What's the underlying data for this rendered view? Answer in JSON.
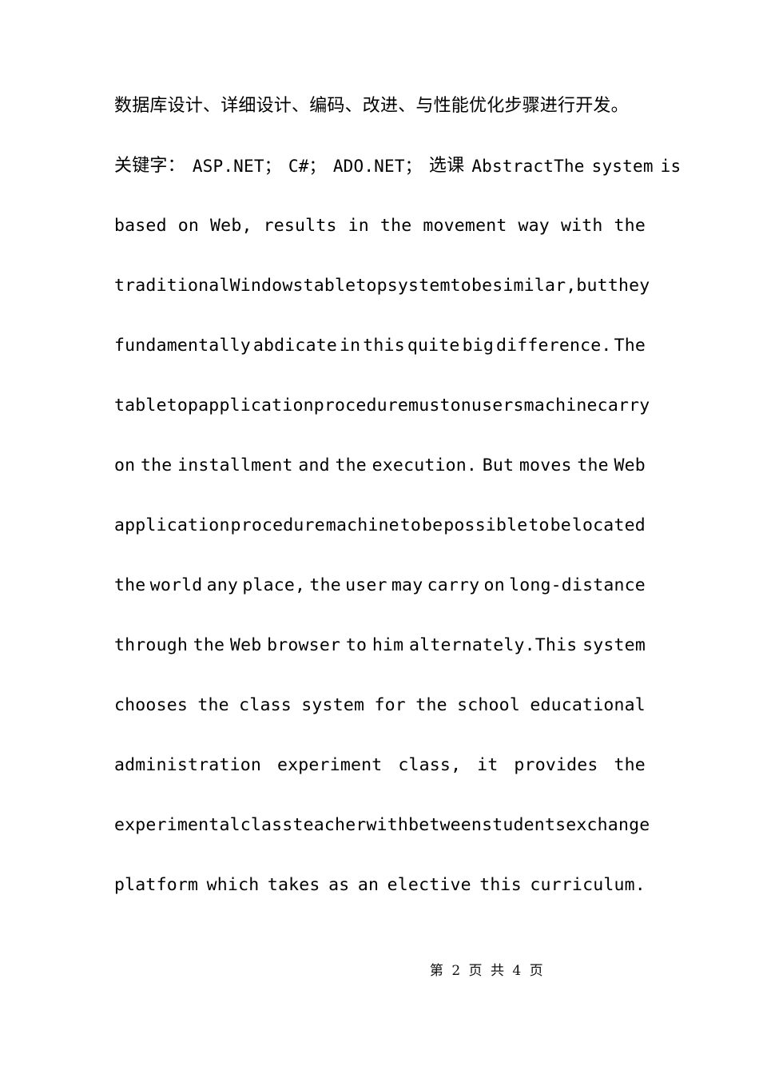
{
  "document": {
    "page_background": "#ffffff",
    "text_color": "#000000",
    "body_lines": [
      {
        "id": "line-1",
        "kind": "cjk-paragraph",
        "align": "natural",
        "text": "数据库设计、详细设计、编码、改进、与性能优化步骤进行开发。",
        "words": [
          "数据库设计、详细设计、编码、改进、与性能优化步骤进行开发。"
        ]
      },
      {
        "id": "line-2",
        "kind": "cjk-mixed",
        "align": "natural",
        "text": "关键字：ASP.NET；C#；ADO.NET；选课 AbstractThe system is",
        "words": [
          "关键字：",
          "ASP.NET；",
          "C#；",
          "ADO.NET；",
          "选课",
          "AbstractThe",
          "system",
          "is"
        ]
      },
      {
        "id": "line-3",
        "kind": "latin",
        "align": "justify",
        "text": "based on Web, results in the movement way with the",
        "words": [
          "based",
          "on",
          "Web,",
          "results",
          "in",
          "the",
          "movement",
          "way",
          "with",
          "the"
        ]
      },
      {
        "id": "line-4",
        "kind": "latin",
        "align": "justify",
        "text": "traditional Windows tabletop system to be similar, but they",
        "words": [
          "traditional",
          "Windows",
          "tabletop",
          "system",
          "to",
          "be",
          "similar,",
          "but",
          "they"
        ]
      },
      {
        "id": "line-5",
        "kind": "latin",
        "align": "justify",
        "text": "fundamentally abdicate in this quite big difference. The",
        "words": [
          "fundamentally",
          "abdicate",
          "in",
          "this",
          "quite",
          "big",
          "difference.",
          "The"
        ]
      },
      {
        "id": "line-6",
        "kind": "latin",
        "align": "justify",
        "text": "tabletop application procedure must on users machine carry",
        "words": [
          "tabletop",
          "application",
          "procedure",
          "must",
          "on",
          "users",
          "machine",
          "carry"
        ]
      },
      {
        "id": "line-7",
        "kind": "latin",
        "align": "justify",
        "text": "on the installment and the execution. But moves the Web",
        "words": [
          "on",
          "the",
          "installment",
          "and",
          "the",
          "execution.",
          "But",
          "moves",
          "the",
          "Web"
        ]
      },
      {
        "id": "line-8",
        "kind": "latin",
        "align": "justify",
        "text": "application procedure machine to be possible to be located",
        "words": [
          "application",
          "procedure",
          "machine",
          "to",
          "be",
          "possible",
          "to",
          "be",
          "located"
        ]
      },
      {
        "id": "line-9",
        "kind": "latin",
        "align": "justify",
        "text": "the world any place, the user may carry on long-distance",
        "words": [
          "the",
          "world",
          "any",
          "place,",
          "the",
          "user",
          "may",
          "carry",
          "on",
          "long-distance"
        ]
      },
      {
        "id": "line-10",
        "kind": "latin",
        "align": "justify",
        "text": "through the Web browser to him alternately.This system",
        "words": [
          "through",
          "the",
          "Web",
          "browser",
          "to",
          "him",
          "alternately.This",
          "system"
        ]
      },
      {
        "id": "line-11",
        "kind": "latin",
        "align": "justify",
        "text": "chooses the class system for the school educational",
        "words": [
          "chooses",
          "the",
          "class",
          "system",
          "for",
          "the",
          "school",
          "educational"
        ]
      },
      {
        "id": "line-12",
        "kind": "latin",
        "align": "justify",
        "text": "administration experiment class, it provides the",
        "words": [
          "administration",
          "experiment",
          "class,",
          "it",
          "provides",
          "the"
        ]
      },
      {
        "id": "line-13",
        "kind": "latin",
        "align": "justify",
        "text": "experimental class teacher with between students exchange",
        "words": [
          "experimental",
          "class",
          "teacher",
          "with",
          "between",
          "students",
          "exchange"
        ]
      },
      {
        "id": "line-14",
        "kind": "latin",
        "align": "justify",
        "text": "platform which takes as an elective this curriculum.",
        "words": [
          "platform",
          "which",
          "takes",
          "as",
          "an",
          "elective",
          "this",
          "curriculum."
        ]
      }
    ]
  },
  "footer": {
    "page_indicator": "第 2 页 共 4 页",
    "current_page": "2",
    "total_pages": "4"
  }
}
